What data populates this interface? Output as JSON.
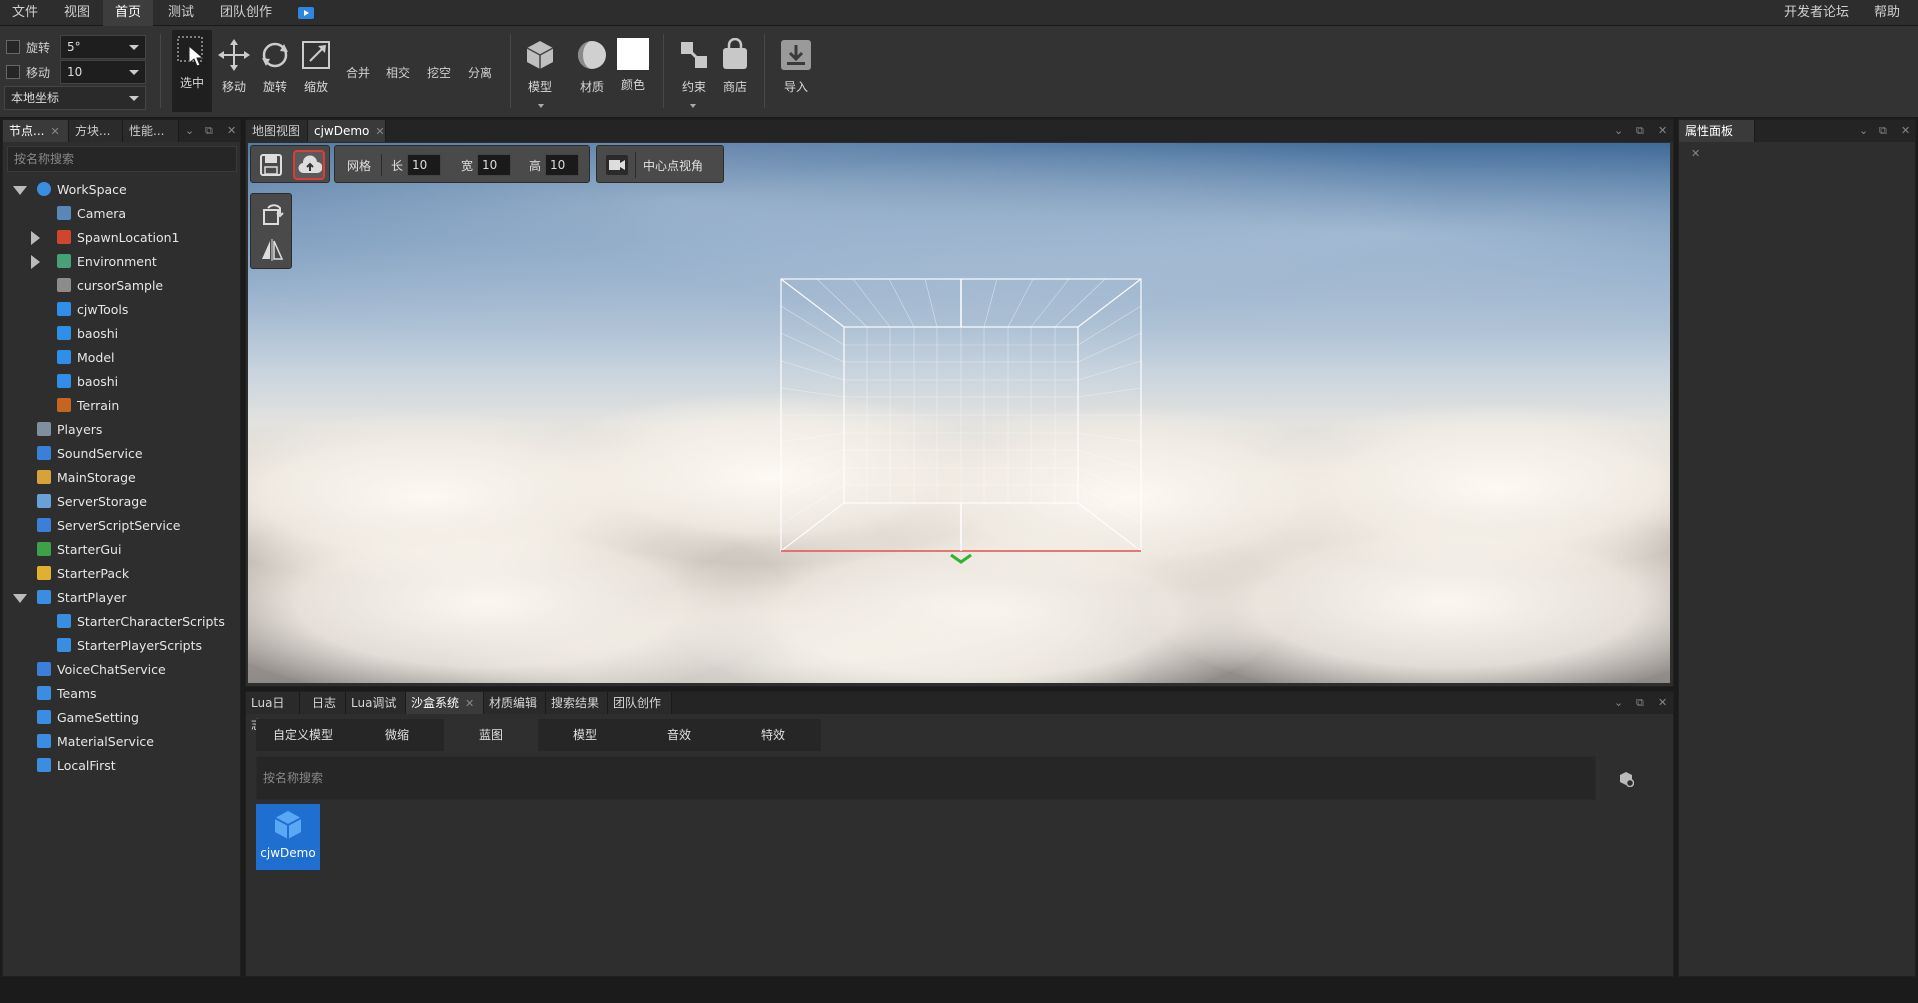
{
  "menubar": {
    "items": [
      "文件",
      "视图",
      "首页",
      "测试",
      "团队创作"
    ],
    "active": "首页",
    "right": [
      "开发者论坛",
      "帮助"
    ]
  },
  "toolbar": {
    "rotate_label": "旋转",
    "rotate_value": "5°",
    "move_label": "移动",
    "move_value": "10",
    "coord_value": "本地坐标",
    "tools": [
      "选中",
      "移动",
      "旋转",
      "缩放"
    ],
    "ops": [
      "合并",
      "相交",
      "挖空",
      "分离"
    ],
    "insert": [
      "模型",
      "材质",
      "颜色"
    ],
    "misc": [
      "约束",
      "商店"
    ],
    "import": "导入"
  },
  "explorer": {
    "tabs": [
      "节点...",
      "方块...",
      "性能..."
    ],
    "search_placeholder": "按名称搜索",
    "items": [
      {
        "label": "WorkSpace",
        "color": "#3a8de0"
      },
      {
        "label": "Camera",
        "color": "#5a87b8"
      },
      {
        "label": "SpawnLocation1",
        "color": "#d0452e"
      },
      {
        "label": "Environment",
        "color": "#47a07a"
      },
      {
        "label": "cursorSample",
        "color": "#8c8c8c"
      },
      {
        "label": "cjwTools",
        "color": "#2f8fe8"
      },
      {
        "label": "baoshi",
        "color": "#2f8fe8"
      },
      {
        "label": "Model",
        "color": "#2f8fe8"
      },
      {
        "label": "baoshi",
        "color": "#2f8fe8"
      },
      {
        "label": "Terrain",
        "color": "#c6651f"
      },
      {
        "label": "Players",
        "color": "#7f8fa0"
      },
      {
        "label": "SoundService",
        "color": "#3a7fd8"
      },
      {
        "label": "MainStorage",
        "color": "#d8a23a"
      },
      {
        "label": "ServerStorage",
        "color": "#6aa0d8"
      },
      {
        "label": "ServerScriptService",
        "color": "#3a7fd8"
      },
      {
        "label": "StarterGui",
        "color": "#3fa04a"
      },
      {
        "label": "StarterPack",
        "color": "#e0b030"
      },
      {
        "label": "StartPlayer",
        "color": "#3a8de0"
      },
      {
        "label": "StarterCharacterScripts",
        "color": "#3a8de0"
      },
      {
        "label": "StarterPlayerScripts",
        "color": "#3a8de0"
      },
      {
        "label": "VoiceChatService",
        "color": "#3a7fd8"
      },
      {
        "label": "Teams",
        "color": "#3a8de0"
      },
      {
        "label": "GameSetting",
        "color": "#3a8de0"
      },
      {
        "label": "MaterialService",
        "color": "#3a8de0"
      },
      {
        "label": "LocalFirst",
        "color": "#3a8de0"
      }
    ]
  },
  "scene": {
    "tabs": [
      "地图视图",
      "cjwDemo"
    ],
    "grid_label": "网格",
    "len_label": "长",
    "len_value": "10",
    "width_label": "宽",
    "width_value": "10",
    "height_label": "高",
    "height_value": "10",
    "center_view": "中心点视角"
  },
  "properties": {
    "tab": "属性面板"
  },
  "bottom": {
    "tabs": [
      "Lua日志",
      "日志",
      "Lua调试",
      "沙盒系统",
      "材质编辑",
      "搜索结果",
      "团队创作"
    ],
    "active_tab": "沙盒系统",
    "subtabs": [
      "自定义模型",
      "微缩",
      "蓝图",
      "模型",
      "音效",
      "特效"
    ],
    "active_subtab": "蓝图",
    "search_placeholder": "按名称搜索",
    "asset": "cjwDemo"
  }
}
